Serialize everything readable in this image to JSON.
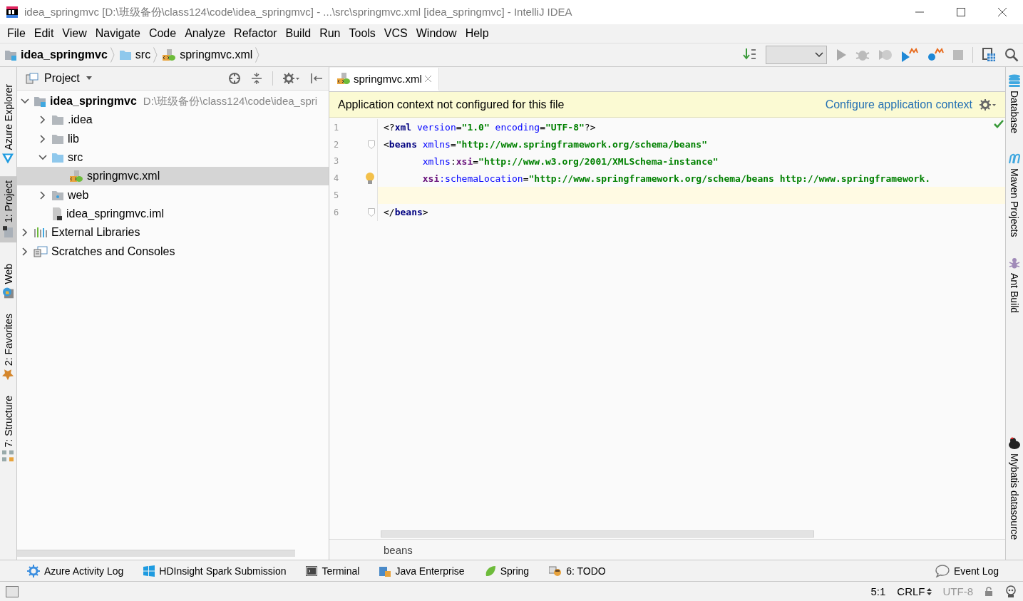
{
  "window": {
    "title": "idea_springmvc [D:\\班级备份\\class124\\code\\idea_springmvc] - ...\\src\\springmvc.xml [idea_springmvc] - IntelliJ IDEA"
  },
  "menu": [
    "File",
    "Edit",
    "View",
    "Navigate",
    "Code",
    "Analyze",
    "Refactor",
    "Build",
    "Run",
    "Tools",
    "VCS",
    "Window",
    "Help"
  ],
  "breadcrumbs": [
    {
      "label": "idea_springmvc",
      "kind": "module"
    },
    {
      "label": "src",
      "kind": "source-folder"
    },
    {
      "label": "springmvc.xml",
      "kind": "xml"
    }
  ],
  "left_strip": {
    "top": [
      {
        "label": "Azure Explorer",
        "kind": "azure",
        "selected": false
      },
      {
        "label": "1: Project",
        "kind": "project",
        "selected": true
      }
    ],
    "bottom": [
      {
        "label": "Web",
        "kind": "web",
        "selected": false
      },
      {
        "label": "2: Favorites",
        "kind": "favorites",
        "selected": false
      },
      {
        "label": "7: Structure",
        "kind": "structure",
        "selected": false
      }
    ]
  },
  "right_strip": {
    "top": [
      {
        "label": "Database",
        "kind": "database"
      },
      {
        "label": "Maven Projects",
        "kind": "maven"
      },
      {
        "label": "Ant Build",
        "kind": "ant"
      }
    ],
    "bottom": [
      {
        "label": "Mybatis datasource",
        "kind": "mybatis"
      }
    ]
  },
  "project": {
    "title": "Project",
    "tree": [
      {
        "label": "idea_springmvc",
        "hint": "D:\\班级备份\\class124\\code\\idea_spri",
        "kind": "module",
        "expanded": true,
        "selected": false,
        "children": [
          {
            "label": ".idea",
            "kind": "folder",
            "expanded": false,
            "selected": false
          },
          {
            "label": "lib",
            "kind": "folder",
            "expanded": false,
            "selected": false
          },
          {
            "label": "src",
            "kind": "source-folder",
            "expanded": true,
            "selected": false,
            "children": [
              {
                "label": "springmvc.xml",
                "kind": "xml",
                "selected": true
              }
            ]
          },
          {
            "label": "web",
            "kind": "web-folder",
            "expanded": false,
            "selected": false
          },
          {
            "label": "idea_springmvc.iml",
            "kind": "iml",
            "selected": false
          }
        ]
      },
      {
        "label": "External Libraries",
        "kind": "libraries",
        "expanded": false,
        "selected": false
      },
      {
        "label": "Scratches and Consoles",
        "kind": "scratches",
        "expanded": false,
        "selected": false
      }
    ]
  },
  "editor": {
    "tabs": [
      {
        "label": "springmvc.xml",
        "selected": true
      }
    ],
    "banner": {
      "message": "Application context not configured for this file",
      "action": "Configure application context"
    },
    "lines": [
      {
        "number": "1",
        "current": false,
        "fold_marker": false,
        "bulb": false,
        "tokens": [
          {
            "kind": "punct",
            "text": "<?"
          },
          {
            "kind": "tag",
            "text": "xml"
          },
          {
            "kind": "attr",
            "text": " version"
          },
          {
            "kind": "punct",
            "text": "="
          },
          {
            "kind": "value",
            "text": "\"1.0\""
          },
          {
            "kind": "attr",
            "text": " encoding"
          },
          {
            "kind": "punct",
            "text": "="
          },
          {
            "kind": "value",
            "text": "\"UTF-8\""
          },
          {
            "kind": "punct",
            "text": "?>"
          }
        ]
      },
      {
        "number": "2",
        "current": false,
        "fold_marker": true,
        "bulb": false,
        "tokens": [
          {
            "kind": "punct",
            "text": "<"
          },
          {
            "kind": "tag",
            "text": "beans"
          },
          {
            "kind": "attr",
            "text": " xmlns"
          },
          {
            "kind": "punct",
            "text": "="
          },
          {
            "kind": "value",
            "text": "\"http://www.springframework.org/schema/beans\""
          }
        ]
      },
      {
        "number": "3",
        "current": false,
        "fold_marker": false,
        "bulb": false,
        "tokens": [
          {
            "kind": "attr",
            "text": "       xmlns"
          },
          {
            "kind": "punct",
            "text": ":"
          },
          {
            "kind": "ns",
            "text": "xsi"
          },
          {
            "kind": "punct",
            "text": "="
          },
          {
            "kind": "value",
            "text": "\"http://www.w3.org/2001/XMLSchema-instance\""
          }
        ]
      },
      {
        "number": "4",
        "current": false,
        "fold_marker": false,
        "bulb": true,
        "tokens": [
          {
            "kind": "ns",
            "text": "       xsi"
          },
          {
            "kind": "attr",
            "text": ":schemaLocation"
          },
          {
            "kind": "punct",
            "text": "="
          },
          {
            "kind": "value",
            "text": "\"http://www.springframework.org/schema/beans http://www.springframework."
          }
        ]
      },
      {
        "number": "5",
        "current": true,
        "fold_marker": false,
        "bulb": false
      },
      {
        "number": "6",
        "current": false,
        "fold_marker": true,
        "bulb": false,
        "tokens": [
          {
            "kind": "punct",
            "text": "</"
          },
          {
            "kind": "tag",
            "text": "beans"
          },
          {
            "kind": "punct",
            "text": ">"
          }
        ]
      }
    ],
    "breadcrumb": "beans"
  },
  "tool_windows": [
    {
      "label": "Azure Activity Log",
      "kind": "gear"
    },
    {
      "label": "HDInsight Spark Submission",
      "kind": "windows"
    },
    {
      "label": "Terminal",
      "kind": "terminal"
    },
    {
      "label": "Java Enterprise",
      "kind": "enterprise"
    },
    {
      "label": "Spring",
      "kind": "spring"
    },
    {
      "label": "6: TODO",
      "kind": "todo"
    }
  ],
  "event_log": "Event Log",
  "status_bar": {
    "position": "5:1",
    "line_separator": "CRLF",
    "encoding": "UTF-8"
  }
}
